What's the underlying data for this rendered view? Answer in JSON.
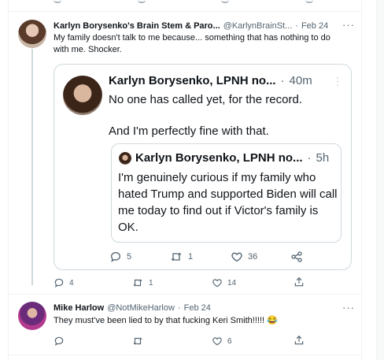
{
  "top_divider": true,
  "tweet1": {
    "display_name": "Karlyn Borysenko's Brain Stem & Paro...",
    "handle": "@KarlynBrainSt...",
    "separator": "·",
    "date": "Feb 24",
    "text_line1": "My family doesn't talk to me because... something that has nothing to do",
    "text_line2": "with me. Shocker.",
    "actions": {
      "replies": "4",
      "retweets": "1",
      "likes": "14"
    }
  },
  "quoted": {
    "display_name": "Karlyn Borysenko, LPNH no...",
    "separator": "·",
    "time": "40m",
    "text_line1": "No one has called yet, for the record.",
    "text_line2": "And I'm perfectly fine with that.",
    "actions": {
      "replies": "5",
      "retweets": "1",
      "likes": "36"
    }
  },
  "nested_quote": {
    "display_name": "Karlyn Borysenko, LPNH no...",
    "separator": "·",
    "time": "5h",
    "text": "I'm genuinely curious if my family who hated Trump and supported Biden will call me today to find out if Victor's family is OK."
  },
  "tweet2": {
    "display_name": "Mike Harlow",
    "handle": "@NotMikeHarlow",
    "separator": "·",
    "date": "Feb 24",
    "text": "They must've been lied to by that fucking Keri Smith!!!!! 😂",
    "actions": {
      "likes": "6"
    }
  },
  "more_label": "···"
}
